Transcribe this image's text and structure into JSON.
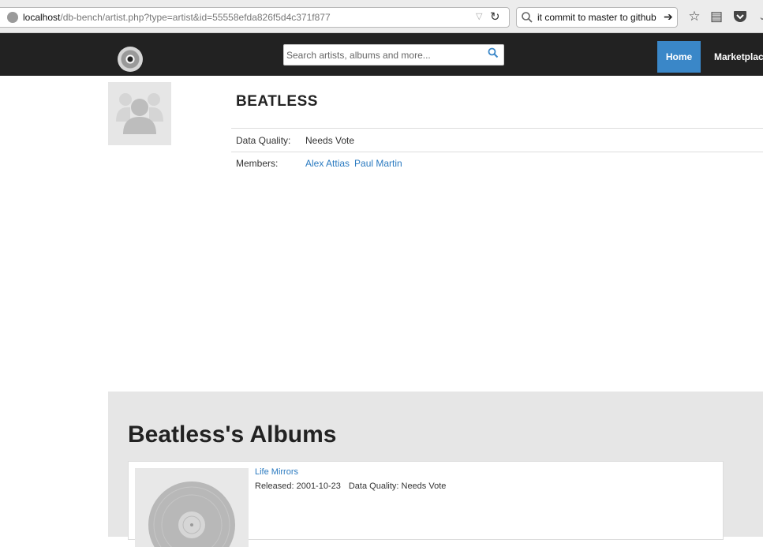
{
  "browser": {
    "url_host": "localhost",
    "url_path": "/db-bench/artist.php?type=artist&id=55558efda826f5d4c371f877",
    "search_text": "it commit to master to github"
  },
  "site": {
    "search_placeholder": "Search artists, albums and more...",
    "nav": {
      "home": "Home",
      "marketplace": "Marketplace"
    },
    "accent_color": "#3a87c8",
    "nav_bg_color": "#222222"
  },
  "artist": {
    "name": "BEATLESS",
    "data_quality_label": "Data Quality:",
    "data_quality_value": "Needs Vote",
    "members_label": "Members:",
    "members": [
      "Alex Attias",
      "Paul Martin"
    ]
  },
  "albums": {
    "heading": "Beatless's Albums",
    "items": [
      {
        "title": "Life Mirrors",
        "released": "Released: 2001-10-23",
        "data_quality": "Data Quality: Needs Vote"
      }
    ]
  },
  "icons": [
    "globe-icon",
    "dropdown-icon",
    "reload-icon",
    "search-icon",
    "arrow-right-icon",
    "star-icon",
    "reading-list-icon",
    "pocket-icon",
    "logo-disc-icon",
    "artist-placeholder-icon",
    "vinyl-icon"
  ]
}
